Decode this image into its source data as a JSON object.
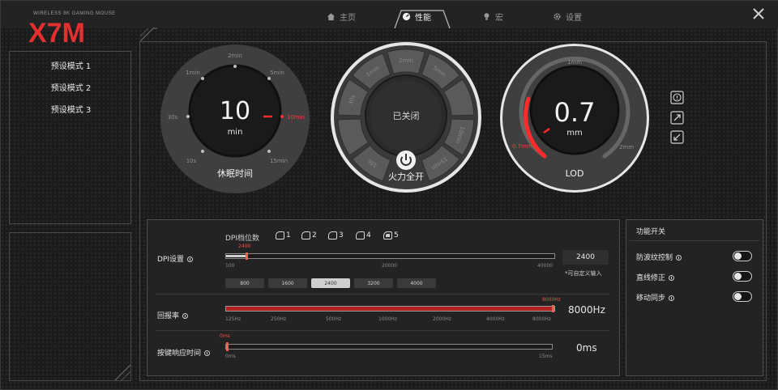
{
  "brand": {
    "tagline": "WIRELESS 8K GAMING MOUSE",
    "logo_text": "X7M"
  },
  "tabs": [
    {
      "label": "主页",
      "icon": "home-icon"
    },
    {
      "label": "性能",
      "icon": "gauge-icon",
      "active": true
    },
    {
      "label": "宏",
      "icon": "bulb-icon"
    },
    {
      "label": "设置",
      "icon": "gear-icon"
    }
  ],
  "presets": [
    "预设模式 1",
    "预设模式 2",
    "预设模式 3"
  ],
  "sleep_dial": {
    "value": "10",
    "unit": "min",
    "label": "休眠时间",
    "selected_marker": "10min",
    "ticks": [
      "2min",
      "5min",
      "1min",
      "30s",
      "10s",
      "15min"
    ]
  },
  "fire_dial": {
    "status": "已关闭",
    "label": "火力全开",
    "segments": [
      "2min",
      "5min",
      "10min",
      "15min",
      "30s",
      "1min",
      "10s"
    ]
  },
  "lod_dial": {
    "value": "0.7",
    "unit": "mm",
    "label": "LOD",
    "tick_top": "1mm",
    "tick_right": "2mm",
    "marker": "0.7mm",
    "level_fraction": 0.3
  },
  "dpi": {
    "label": "DPI设置",
    "levels_label": "DPI档位数",
    "levels": [
      "1",
      "2",
      "3",
      "4",
      "5"
    ],
    "selected_level": "5",
    "slider_value_label": "2400",
    "slider_min": "100",
    "slider_mid": "20000",
    "slider_max": "40000",
    "slider_fraction": 0.06,
    "value": "2400",
    "custom_note": "*可自定义输入",
    "presets": [
      "800",
      "1600",
      "2400",
      "3200",
      "4000"
    ],
    "selected_preset": "2400"
  },
  "report_rate": {
    "label": "回报率",
    "value": "8000Hz",
    "slider_value_label": "8000Hz",
    "ticks": [
      "125Hz",
      "250Hz",
      "500Hz",
      "1000Hz",
      "2000Hz",
      "4000Hz",
      "8000Hz"
    ],
    "fraction": 1.0
  },
  "key_response": {
    "label": "按键响应时间",
    "value": "0ms",
    "slider_value_label": "0ms",
    "min": "0ms",
    "max": "15ms",
    "fraction": 0.0
  },
  "functions": {
    "title": "功能开关",
    "items": [
      {
        "label": "防波纹控制",
        "on": false
      },
      {
        "label": "直线修正",
        "on": false
      },
      {
        "label": "移动同步",
        "on": false
      }
    ]
  },
  "colors": {
    "accent": "#ff2b2b",
    "panel": "#232323",
    "bg": "#1b1b1b"
  }
}
